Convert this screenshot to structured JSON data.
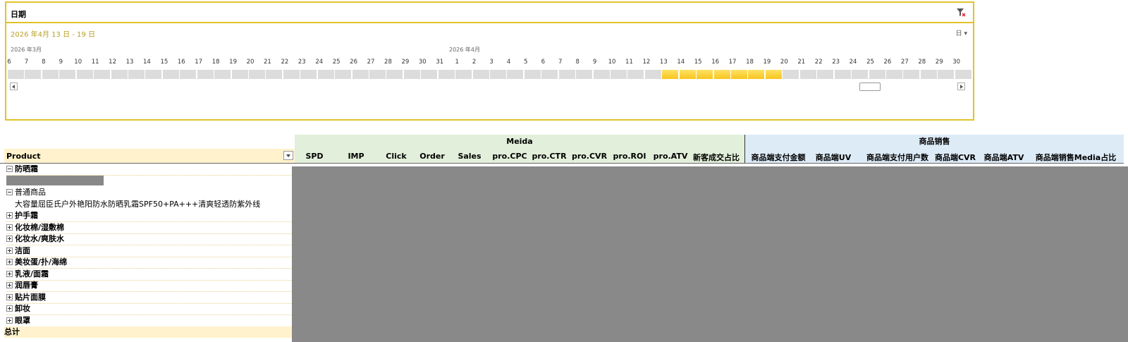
{
  "slicer": {
    "title": "日期",
    "range_label": "2026 年4月 13 日 - 19 日",
    "level_label": "日",
    "months": [
      "2026 年3月",
      "2026 年4月"
    ],
    "days": [
      "6",
      "7",
      "8",
      "9",
      "10",
      "11",
      "12",
      "13",
      "14",
      "15",
      "16",
      "17",
      "18",
      "19",
      "20",
      "21",
      "22",
      "23",
      "24",
      "25",
      "26",
      "27",
      "28",
      "29",
      "30",
      "31",
      "1",
      "2",
      "3",
      "4",
      "5",
      "6",
      "7",
      "8",
      "9",
      "10",
      "11",
      "12",
      "13",
      "14",
      "15",
      "16",
      "17",
      "18",
      "19",
      "20",
      "21",
      "22",
      "23",
      "24",
      "25",
      "26",
      "27",
      "28",
      "29",
      "30"
    ],
    "selected_range": [
      "13",
      "19"
    ]
  },
  "pivot": {
    "group_meida": "Meida",
    "group_sales": "商品销售",
    "product_header": "Product",
    "meida_columns": [
      "SPD",
      "IMP",
      "Click",
      "Order",
      "Sales",
      "pro.CPC",
      "pro.CTR",
      "pro.CVR",
      "pro.ROI",
      "pro.ATV",
      "新客成交占比"
    ],
    "sales_columns": [
      "商品端支付金额",
      "商品端UV",
      "商品端支付用户数",
      "商品端CVR",
      "商品端ATV",
      "商品端销售Media占比"
    ],
    "rows": [
      {
        "label": "防晒霜",
        "type": "group-expanded"
      },
      {
        "label": "",
        "type": "redacted"
      },
      {
        "label": "普通商品",
        "type": "sub-expanded"
      },
      {
        "label": "大容量屈臣氏户外艳阳防水防晒乳霜SPF50+PA+++清爽轻透防紫外线",
        "type": "item"
      },
      {
        "label": "护手霜",
        "type": "group"
      },
      {
        "label": "化妆棉/湿敷棉",
        "type": "group"
      },
      {
        "label": "化妆水/爽肤水",
        "type": "group"
      },
      {
        "label": "洁面",
        "type": "group"
      },
      {
        "label": "美妆蛋/扑/海绵",
        "type": "group"
      },
      {
        "label": "乳液/面霜",
        "type": "group"
      },
      {
        "label": "润唇膏",
        "type": "group"
      },
      {
        "label": "贴片面膜",
        "type": "group"
      },
      {
        "label": "卸妆",
        "type": "group"
      },
      {
        "label": "眼罩",
        "type": "group"
      },
      {
        "label": "总计",
        "type": "total"
      }
    ]
  }
}
